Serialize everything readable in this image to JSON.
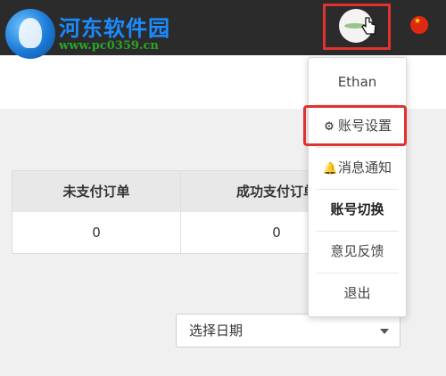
{
  "watermark": {
    "title": "河东软件园",
    "url": "www.pc0359.cn"
  },
  "header": {
    "avatar_icon": "user-avatar",
    "flag_icon": "china-flag-icon"
  },
  "stats": {
    "columns": [
      "未支付订单",
      "成功支付订单"
    ],
    "values": [
      "0",
      "0"
    ]
  },
  "filters": {
    "date_select_label": "选择日期"
  },
  "user_menu": {
    "username": "Ethan",
    "items": [
      {
        "label": "账号设置",
        "icon": "gear-icon"
      },
      {
        "label": "消息通知",
        "icon": "bell-icon"
      },
      {
        "label": "账号切换"
      },
      {
        "label": "意见反馈"
      },
      {
        "label": "退出"
      }
    ]
  },
  "colors": {
    "topbar": "#2b2b2b",
    "highlight": "#e0332f",
    "watermark_title": "#1a8cff",
    "watermark_url": "#2aa52a"
  }
}
